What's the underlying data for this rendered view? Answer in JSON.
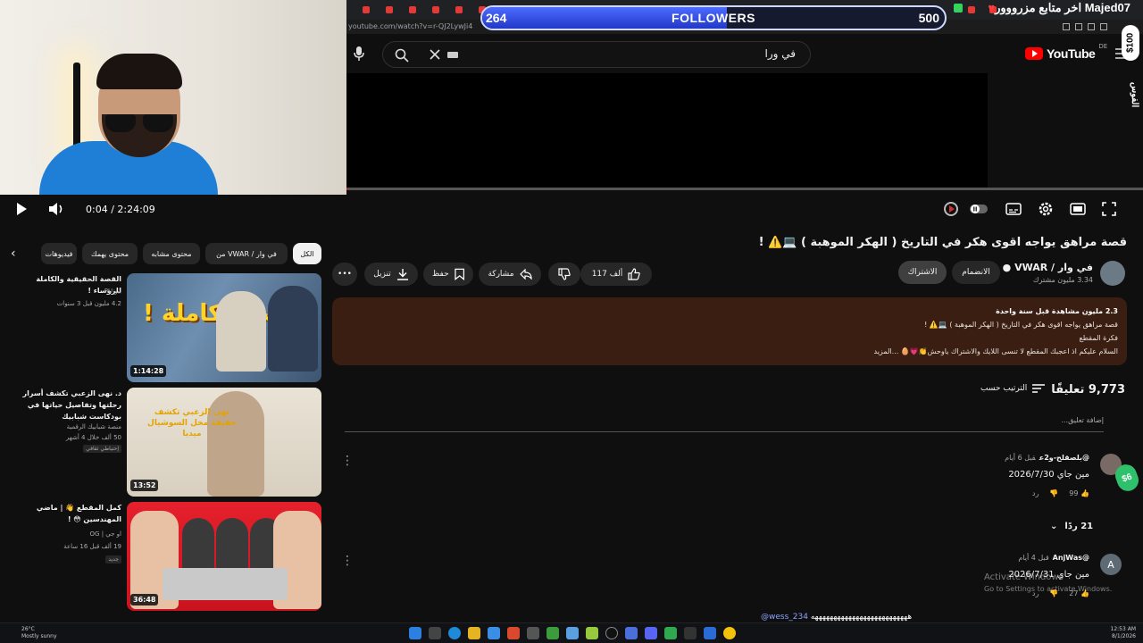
{
  "overlay": {
    "followers_label": "FOLLOWERS",
    "followers_current": "264",
    "followers_goal": "500",
    "followers_progress": 0.528,
    "top_right_text": "Majed07 اخر متابع مزرووور",
    "donation_badge": "$100",
    "side_badge_text": "الفوس",
    "corner_badge": "$6",
    "chat_user": "@wess_234",
    "chat_text": "ههههههههههههههههههههههههههه"
  },
  "browser": {
    "url": "youtube.com/watch?v=r-QJ2LywJi4"
  },
  "header": {
    "search_query": "في ورا",
    "logo_text": "YouTube",
    "logo_region": "DE"
  },
  "player": {
    "time": "0:04 / 2:24:09",
    "progress_fraction": 0.0005
  },
  "video": {
    "title": "قصة مراهق يواجه اقوى هكر في التاريخ ( الهكر الموهبة ) 💻⚠️ !",
    "channel_name": "في وار / VWAR",
    "channel_subs": "3.34 مليون مشترك",
    "join_label": "الانضمام",
    "subscribe_label": "الاشتراك",
    "like_count": "117 ألف",
    "share_label": "مشاركة",
    "save_label": "حفظ",
    "download_label": "تنزيل",
    "description": {
      "line1": "2.3 مليون مشاهدة  قبل سنة واحدة",
      "line2": "قصة مراهق يواجه اقوى هكر في التاريخ ( الهكر الموهبة ) 💻⚠️ !",
      "line3": "فكرة المقطع",
      "line4": "السلام عليكم  اذ اعجبك المقطع  لا تنسى اللايك والاشتراك ياوحش👏💗🥚  ...المزيد"
    }
  },
  "comments": {
    "count_label": "9,773 تعليقًا",
    "sort_label": "الترتيب حسب",
    "add_placeholder": "إضافة تعليق...",
    "replies_label": "21 ردًا",
    "items": [
      {
        "author": "@بلصقلح-و2ع",
        "time": "قبل 6 أيام",
        "text": "مين جاي 2026/7/30",
        "likes": "99",
        "reply_label": "رد"
      },
      {
        "author": "@AnjWas",
        "time": "قبل 4 أيام",
        "text": "مين جاي 2026/7/31",
        "likes": "27",
        "reply_label": "رد",
        "avatar_letter": "A"
      }
    ]
  },
  "chips": [
    "الكل",
    "من VWAR / في وار",
    "محتوى مشابه",
    "محتوى يهمك",
    "فيديوهات"
  ],
  "recommendations": [
    {
      "title": "القصة الحقيقية والكاملة للزوساء !",
      "channel": "بيو PU",
      "meta": "4.2 مليون  قبل 3 سنوات",
      "duration": "1:14:28",
      "thumb_text": "القصة الكاملة !"
    },
    {
      "title": "د. نهى الزعبي تكشف أسرار رحلتها وتفاصيل حياتها في بودكاست شبابيك",
      "channel": "منصة شبابيك الرقمية",
      "meta": "50 ألف  خلال 4 أشهر",
      "duration": "13:52",
      "tag": "إحتياطي ثقافي",
      "thumb_text": "نهى الزعبي تكشف حقيقة مخل السوشيال ميديا"
    },
    {
      "title": "كمل المقطع 👋 | ماضي المهندسين 😳 !",
      "channel": "او جي | OG",
      "meta": "19 ألف  قبل 16 ساعة",
      "duration": "36:48",
      "tag": "جديد"
    }
  ],
  "activate": {
    "line1": "Activate Windows",
    "line2": "Go to Settings to activate Windows."
  },
  "taskbar": {
    "weather": "26°C",
    "weather_sub": "Mostly sunny",
    "clock": "12:53 AM",
    "date": "8/1/2026"
  }
}
